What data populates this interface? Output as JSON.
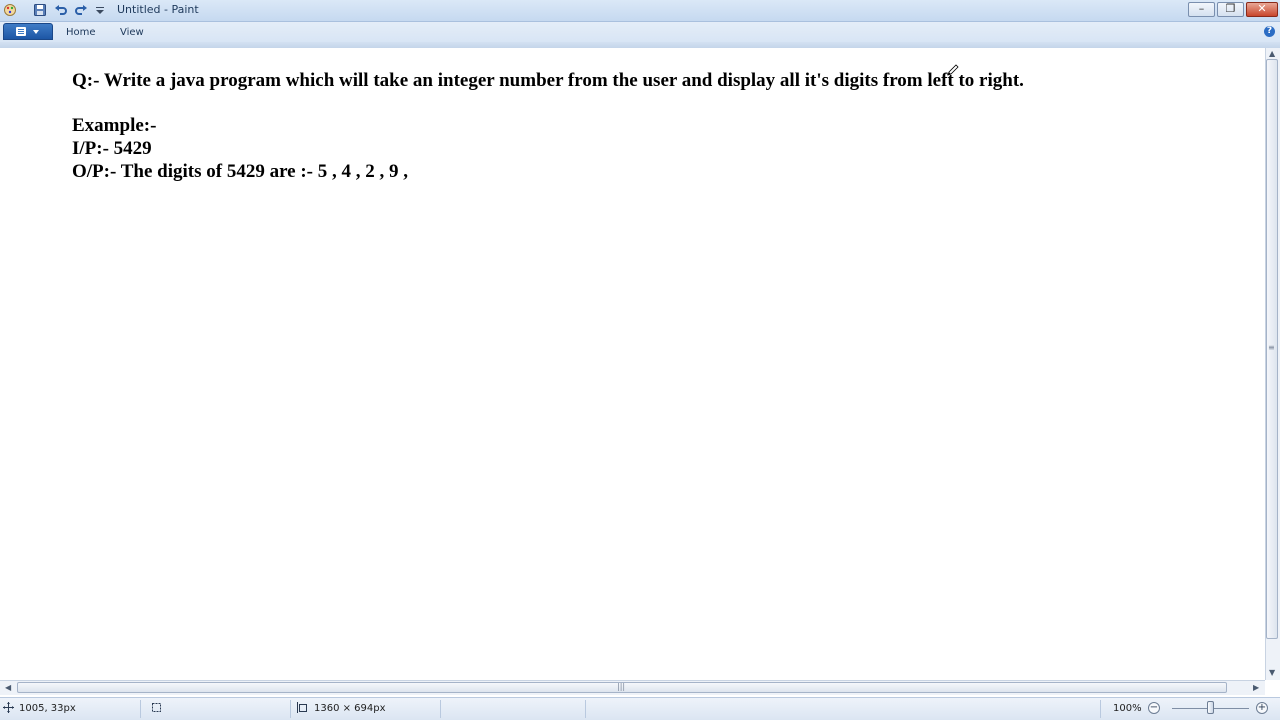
{
  "window": {
    "title": "Untitled - Paint"
  },
  "ribbon": {
    "tabs": [
      "Home",
      "View"
    ],
    "help_glyph": "?"
  },
  "canvas": {
    "lines": [
      "Q:- Write a java program which will take an integer number from the user and display all it's digits from left to right.",
      "Example:-",
      "I/P:- 5429",
      "O/P:- The digits of 5429 are :- 5 , 4 , 2 , 9 ,"
    ]
  },
  "status": {
    "cursor_position": "1005, 33px",
    "image_size": "1360 × 694px",
    "zoom": "100%"
  },
  "icons": {
    "app": "paint-app-icon",
    "save": "save-icon",
    "undo": "undo-icon",
    "redo": "redo-icon",
    "customize": "chevron-down-icon",
    "cursor": "pencil-cursor-icon"
  },
  "colors": {
    "accent": "#2b6cc4",
    "close": "#c9462c"
  }
}
